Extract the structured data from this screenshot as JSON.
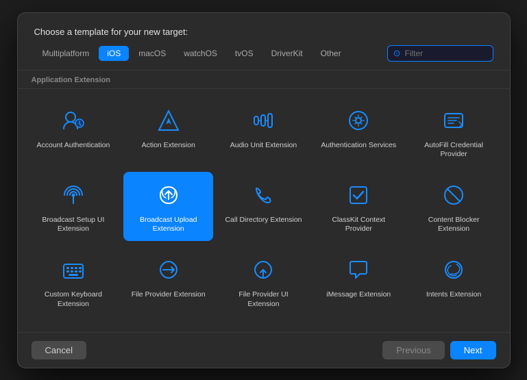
{
  "dialog": {
    "title": "Choose a template for your new target:",
    "section_label": "Application Extension"
  },
  "tabs": [
    {
      "label": "Multiplatform",
      "active": false
    },
    {
      "label": "iOS",
      "active": true
    },
    {
      "label": "macOS",
      "active": false
    },
    {
      "label": "watchOS",
      "active": false
    },
    {
      "label": "tvOS",
      "active": false
    },
    {
      "label": "DriverKit",
      "active": false
    },
    {
      "label": "Other",
      "active": false
    }
  ],
  "filter": {
    "placeholder": "Filter"
  },
  "items": [
    {
      "id": "account-auth",
      "label": "Account Authentication",
      "selected": false
    },
    {
      "id": "action-ext",
      "label": "Action Extension",
      "selected": false
    },
    {
      "id": "audio-unit",
      "label": "Audio Unit Extension",
      "selected": false
    },
    {
      "id": "auth-services",
      "label": "Authentication Services",
      "selected": false
    },
    {
      "id": "autofill",
      "label": "AutoFill Credential Provider",
      "selected": false
    },
    {
      "id": "broadcast-setup",
      "label": "Broadcast Setup UI Extension",
      "selected": false
    },
    {
      "id": "broadcast-upload",
      "label": "Broadcast Upload Extension",
      "selected": true
    },
    {
      "id": "call-directory",
      "label": "Call Directory Extension",
      "selected": false
    },
    {
      "id": "classkit",
      "label": "ClassKit Context Provider",
      "selected": false
    },
    {
      "id": "content-blocker",
      "label": "Content Blocker Extension",
      "selected": false
    },
    {
      "id": "custom-keyboard",
      "label": "Custom Keyboard Extension",
      "selected": false
    },
    {
      "id": "file-provider",
      "label": "File Provider Extension",
      "selected": false
    },
    {
      "id": "file-provider-ui",
      "label": "File Provider UI Extension",
      "selected": false
    },
    {
      "id": "imessage",
      "label": "iMessage Extension",
      "selected": false
    },
    {
      "id": "intents",
      "label": "Intents Extension",
      "selected": false
    },
    {
      "id": "more1",
      "label": "",
      "selected": false
    },
    {
      "id": "more2",
      "label": "",
      "selected": false
    },
    {
      "id": "more3",
      "label": "",
      "selected": false
    },
    {
      "id": "more4",
      "label": "",
      "selected": false
    },
    {
      "id": "more5",
      "label": "",
      "selected": false
    }
  ],
  "footer": {
    "cancel": "Cancel",
    "previous": "Previous",
    "next": "Next"
  }
}
